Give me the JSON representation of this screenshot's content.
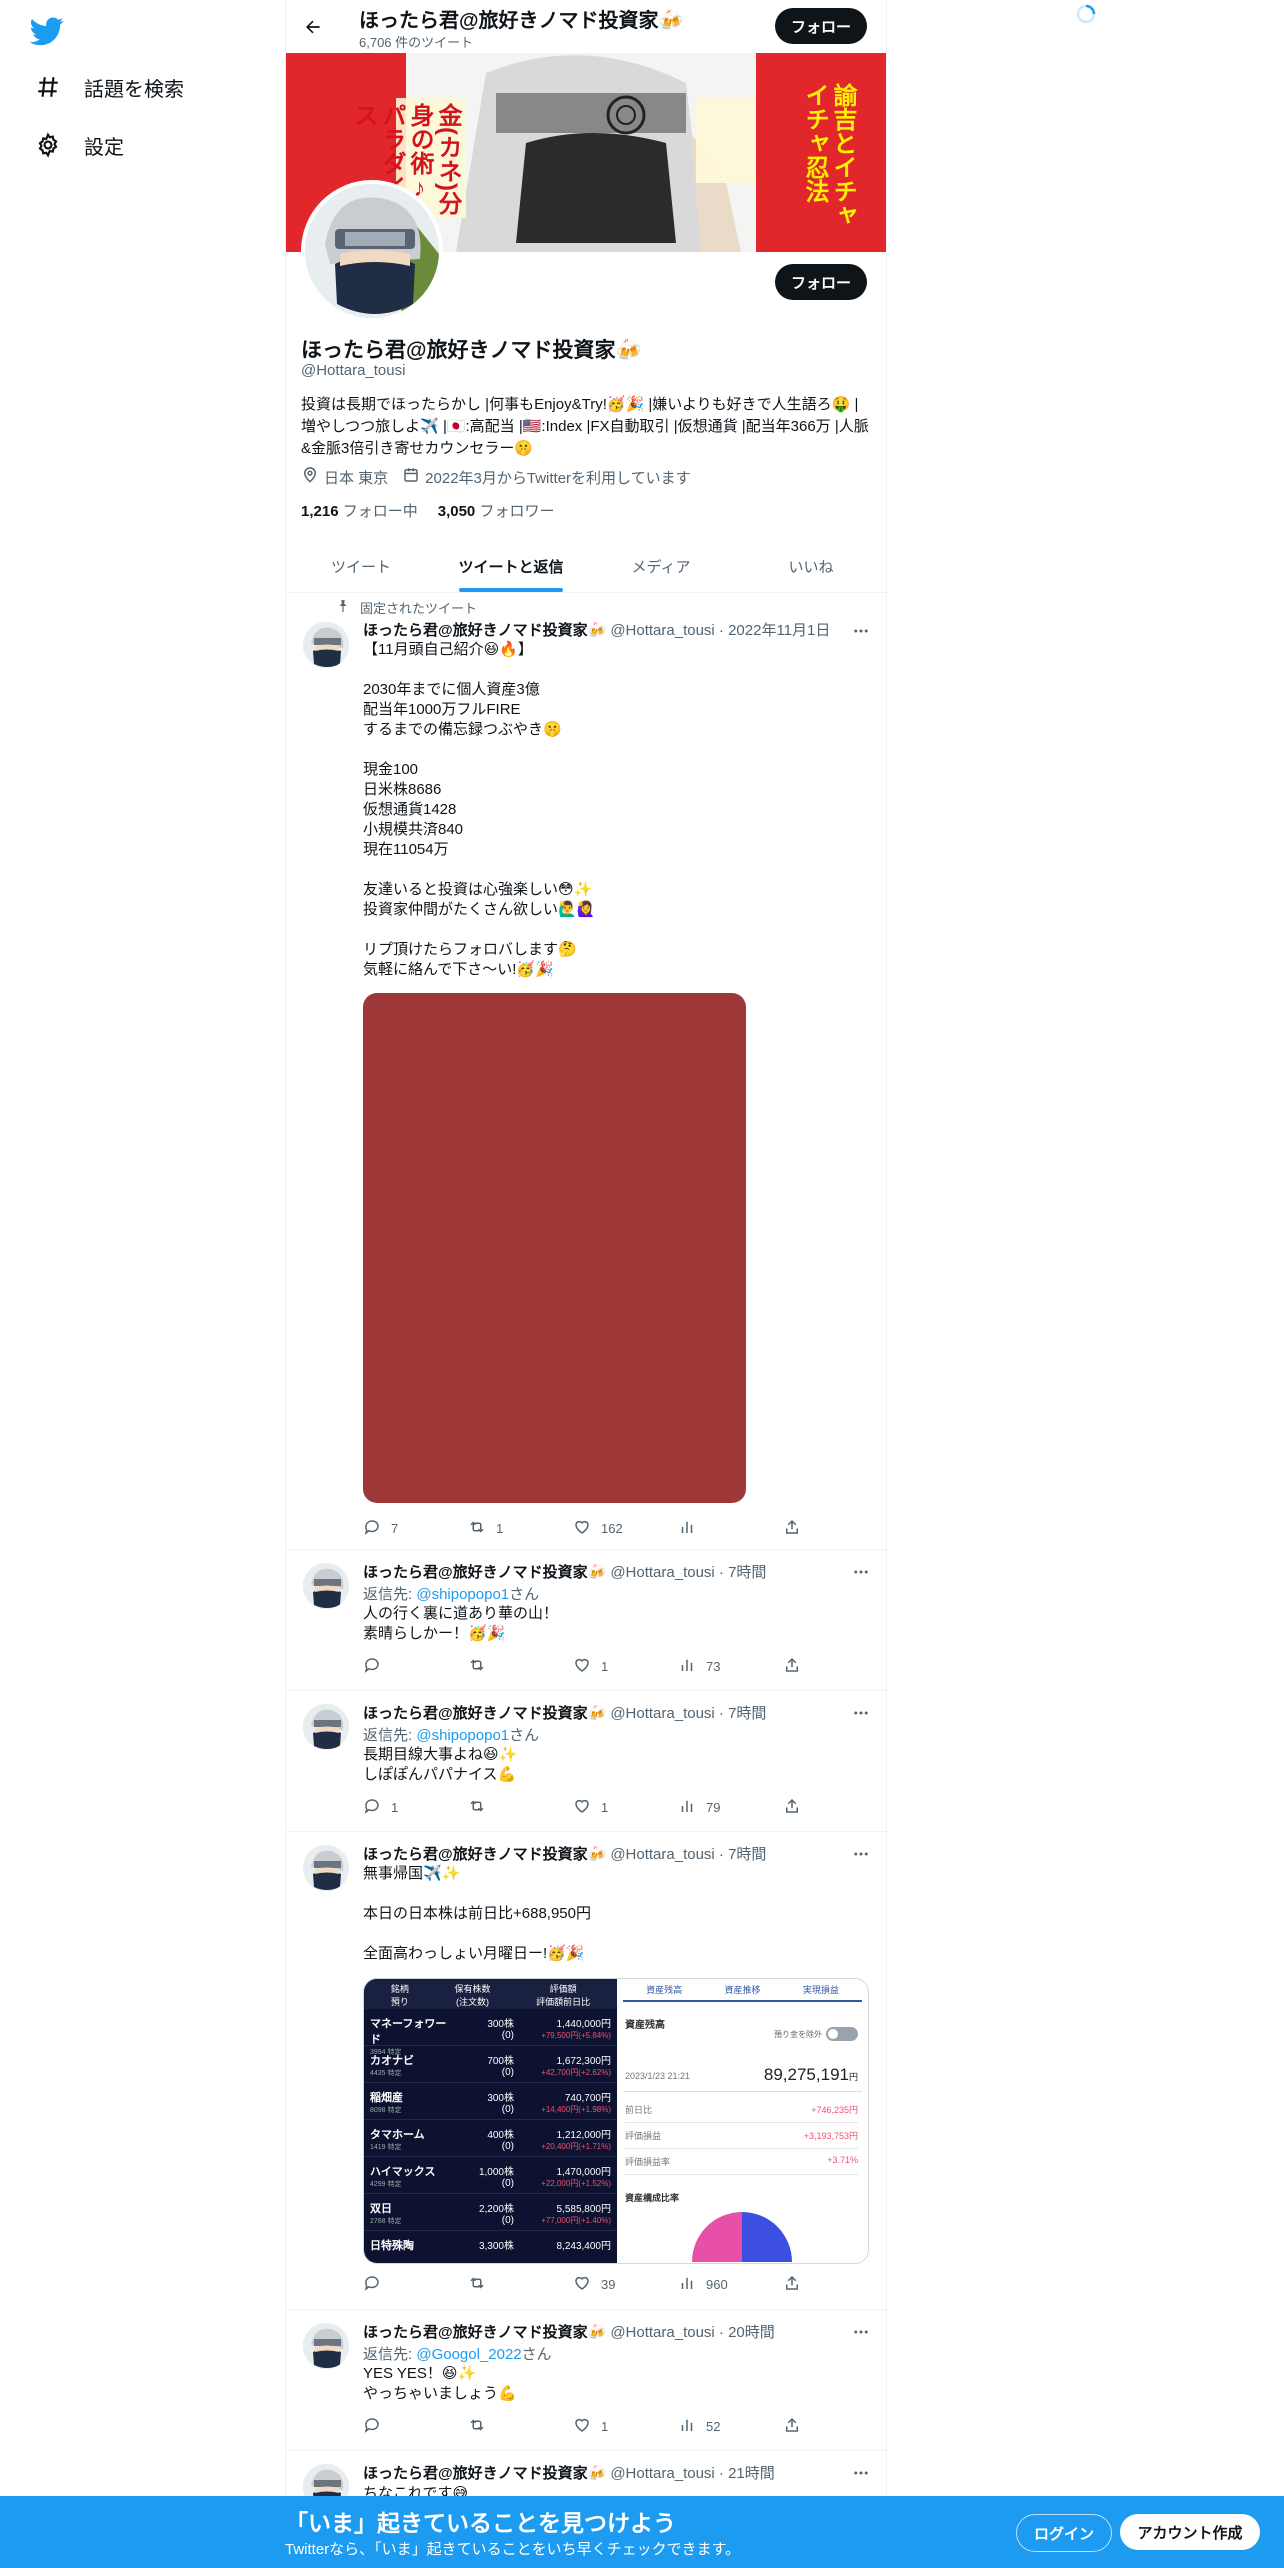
{
  "nav": {
    "items": [
      {
        "label": "話題を検索",
        "icon": "hashtag-icon"
      },
      {
        "label": "設定",
        "icon": "gear-icon"
      }
    ]
  },
  "header": {
    "name": "ほったら君@旅好きノマド投資家🍻",
    "tweet_count": "6,706 件のツイート",
    "follow_label": "フォロー"
  },
  "banner": {
    "text_right": "諭吉とイチャイチャ忍法",
    "text_left": "金(カネ)分身の術♪パラダイス"
  },
  "profile": {
    "name": "ほったら君@旅好きノマド投資家🍻",
    "handle": "@Hottara_tousi",
    "follow_label": "フォロー",
    "bio": "投資は長期でほったらかし |何事もEnjoy&Try!🥳🎉 |嫌いよりも好きで人生語ろ🤑 |増やしつつ旅しよ✈️ |🇯🇵:高配当 |🇺🇸:Index |FX自動取引 |仮想通貨 |配当年366万 |人脈&金脈3倍引き寄せカウンセラー🤫",
    "location": "日本 東京",
    "joined": "2022年3月からTwitterを利用しています",
    "following_count": "1,216",
    "following_label": "フォロー中",
    "followers_count": "3,050",
    "followers_label": "フォロワー"
  },
  "tabs": [
    "ツイート",
    "ツイートと返信",
    "メディア",
    "いいね"
  ],
  "tweets": {
    "pinned": {
      "pinned_label": "固定されたツイート",
      "name": "ほったら君@旅好きノマド投資家🍻",
      "meta": "@Hottara_tousi · 2022年11月1日",
      "text": "【11月頭自己紹介😆🔥】\n\n2030年までに個人資産3億\n配当年1000万フルFIRE\nするまでの備忘録つぶやき🤫\n\n現金100\n日米株8686\n仮想通貨1428\n小規模共済840\n現在11054万\n\n友達いると投資は心強楽しい😳✨\n投資家仲間がたくさん欲しい🙋‍♂️🙋‍♀️\n\nリプ頂けたらフォロバします🤔\n気軽に絡んで下さ〜い!🥳🎉",
      "reply": "7",
      "retweet": "1",
      "like": "162",
      "views": ""
    },
    "t2": {
      "name": "ほったら君@旅好きノマド投資家🍻",
      "meta": "@Hottara_tousi · 7時間",
      "reply_prefix": "返信先: ",
      "reply_to": "@shipopopo1",
      "reply_suffix": "さん",
      "text": "人の行く裏に道あり華の山！\n素晴らしかー！🥳🎉",
      "reply": "",
      "retweet": "",
      "like": "1",
      "views": "73"
    },
    "t3": {
      "name": "ほったら君@旅好きノマド投資家🍻",
      "meta": "@Hottara_tousi · 7時間",
      "reply_prefix": "返信先: ",
      "reply_to": "@shipopopo1",
      "reply_suffix": "さん",
      "text": "長期目線大事よね😆✨\nしぽぽんパパナイス💪",
      "reply": "1",
      "retweet": "",
      "like": "1",
      "views": "79"
    },
    "t4": {
      "name": "ほったら君@旅好きノマド投資家🍻",
      "meta": "@Hottara_tousi · 7時間",
      "text": "無事帰国✈️✨\n\n本日の日本株は前日比+688,950円\n\n全面高わっしょい月曜日ー!🥳🎉",
      "reply": "",
      "retweet": "",
      "like": "39",
      "views": "960",
      "image": {
        "left_headers": [
          "銘柄\n預り",
          "保有株数\n(注文数)",
          "評価額\n評価額前日比"
        ],
        "rows": [
          {
            "name": "マネーフォワード",
            "code": "3994 特定",
            "qty": "300株",
            "sub": "(0)",
            "value": "1,440,000円",
            "change": "+79,500円(+5.84%)"
          },
          {
            "name": "カオナビ",
            "code": "4435 特定",
            "qty": "700株",
            "sub": "(0)",
            "value": "1,672,300円",
            "change": "+42,700円(+2.62%)"
          },
          {
            "name": "稲畑産",
            "code": "8098 特定",
            "qty": "300株",
            "sub": "(0)",
            "value": "740,700円",
            "change": "+14,400円(+1.98%)"
          },
          {
            "name": "タマホーム",
            "code": "1419 特定",
            "qty": "400株",
            "sub": "(0)",
            "value": "1,212,000円",
            "change": "+20,400円(+1.71%)"
          },
          {
            "name": "ハイマックス",
            "code": "4299 特定",
            "qty": "1,000株",
            "sub": "(0)",
            "value": "1,470,000円",
            "change": "+22,000円(+1.52%)"
          },
          {
            "name": "双日",
            "code": "2768 特定",
            "qty": "2,200株",
            "sub": "(0)",
            "value": "5,585,800円",
            "change": "+77,000円(+1.40%)"
          },
          {
            "name": "日特殊陶",
            "code": "",
            "qty": "3,300株",
            "sub": "",
            "value": "8,243,400円",
            "change": ""
          }
        ],
        "right_tabs": [
          "資産残高",
          "資産推移",
          "実現損益"
        ],
        "right_title": "資産残高",
        "toggle_label": "預り金を除外",
        "datetime": "2023/1/23 21:21",
        "total": "89,275,191",
        "total_unit": "円",
        "lines": [
          {
            "label": "前日比",
            "value": "+746,235円"
          },
          {
            "label": "評価損益",
            "value": "+3,193,753円"
          },
          {
            "label": "評価損益率",
            "value": "+3.71%"
          }
        ],
        "ratio_title": "資産構成比率"
      }
    },
    "t5": {
      "name": "ほったら君@旅好きノマド投資家🍻",
      "meta": "@Hottara_tousi · 20時間",
      "reply_prefix": "返信先: ",
      "reply_to": "@Googol_2022",
      "reply_suffix": "さん",
      "text": "YES YES！😆✨\nやっちゃいましょう💪",
      "reply": "",
      "retweet": "",
      "like": "1",
      "views": "52"
    },
    "t6": {
      "name": "ほったら君@旅好きノマド投資家🍻",
      "meta": "@Hottara_tousi · 21時間",
      "text": "ちなこれです😅"
    }
  },
  "bottom_bar": {
    "title": "「いま」起きていることを見つけよう",
    "subtitle": "Twitterなら、「いま」起きていることをいち早くチェックできます。",
    "login": "ログイン",
    "signup": "アカウント作成"
  },
  "colors": {
    "accent": "#1d9bf0",
    "banner_red": "#e1262c",
    "image_placeholder": "#9e3737"
  }
}
